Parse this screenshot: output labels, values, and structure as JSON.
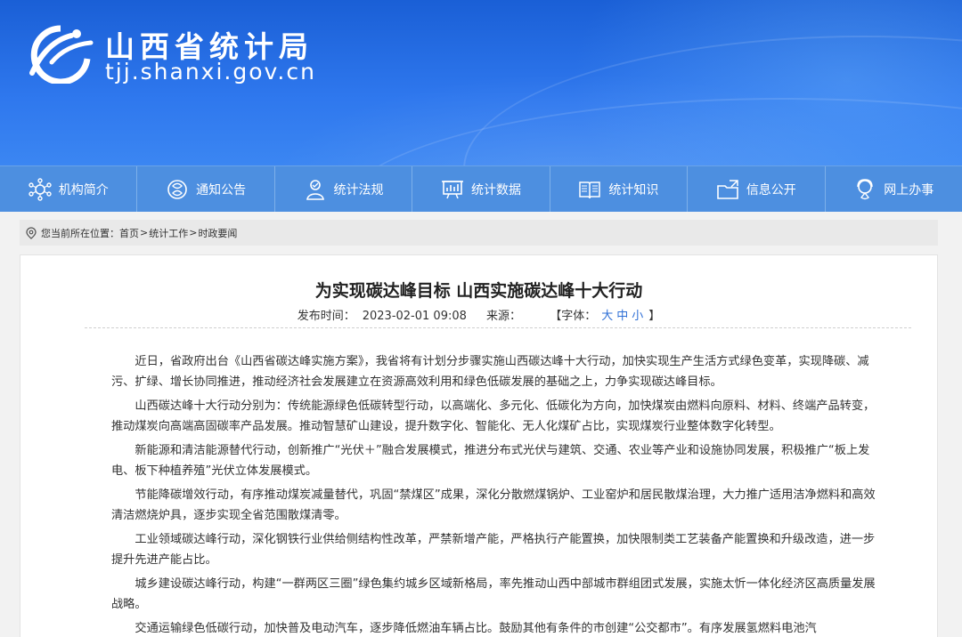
{
  "header": {
    "site_name": "山西省统计局",
    "site_domain": "tjj.shanxi.gov.cn",
    "accent_color": "#2f78ee"
  },
  "nav": {
    "items": [
      {
        "label": "机构简介",
        "icon": "org-icon"
      },
      {
        "label": "通知公告",
        "icon": "notice-icon"
      },
      {
        "label": "统计法规",
        "icon": "law-icon"
      },
      {
        "label": "统计数据",
        "icon": "data-icon"
      },
      {
        "label": "统计知识",
        "icon": "knowledge-icon"
      },
      {
        "label": "信息公开",
        "icon": "folder-icon"
      },
      {
        "label": "网上办事",
        "icon": "online-service-icon"
      }
    ]
  },
  "breadcrumb": {
    "prefix": "您当前所在位置：",
    "items": [
      "首页",
      "统计工作",
      "时政要闻"
    ],
    "separator": ">"
  },
  "article": {
    "title": "为实现碳达峰目标 山西实施碳达峰十大行动",
    "publish_label": "发布时间：",
    "publish_time": "2023-02-01 09:08",
    "source_label": "来源：",
    "font_label": "【字体：",
    "font_sizes": [
      "大",
      "中",
      "小"
    ],
    "font_close": "】",
    "paragraphs": [
      "近日，省政府出台《山西省碳达峰实施方案》，我省将有计划分步骤实施山西碳达峰十大行动，加快实现生产生活方式绿色变革，实现降碳、减污、扩绿、增长协同推进，推动经济社会发展建立在资源高效利用和绿色低碳发展的基础之上，力争实现碳达峰目标。",
      "山西碳达峰十大行动分别为：传统能源绿色低碳转型行动，以高端化、多元化、低碳化为方向，加快煤炭由燃料向原料、材料、终端产品转变，推动煤炭向高端高固碳率产品发展。推动智慧矿山建设，提升数字化、智能化、无人化煤矿占比，实现煤炭行业整体数字化转型。",
      "新能源和清洁能源替代行动，创新推广“光伏＋”融合发展模式，推进分布式光伏与建筑、交通、农业等产业和设施协同发展，积极推广“板上发电、板下种植养殖”光伏立体发展模式。",
      "节能降碳增效行动，有序推动煤炭减量替代，巩固“禁煤区”成果，深化分散燃煤锅炉、工业窑炉和居民散煤治理，大力推广适用洁净燃料和高效清洁燃烧炉具，逐步实现全省范围散煤清零。",
      "工业领域碳达峰行动，深化钢铁行业供给侧结构性改革，严禁新增产能，严格执行产能置换，加快限制类工艺装备产能置换和升级改造，进一步提升先进产能占比。",
      "城乡建设碳达峰行动，构建“一群两区三圈”绿色集约城乡区域新格局，率先推动山西中部城市群组团式发展，实施太忻一体化经济区高质量发展战略。",
      "交通运输绿色低碳行动，加快普及电动汽车，逐步降低燃油车辆占比。鼓励其他有条件的市创建“公交都市”。有序发展氢燃料电池汽"
    ]
  }
}
